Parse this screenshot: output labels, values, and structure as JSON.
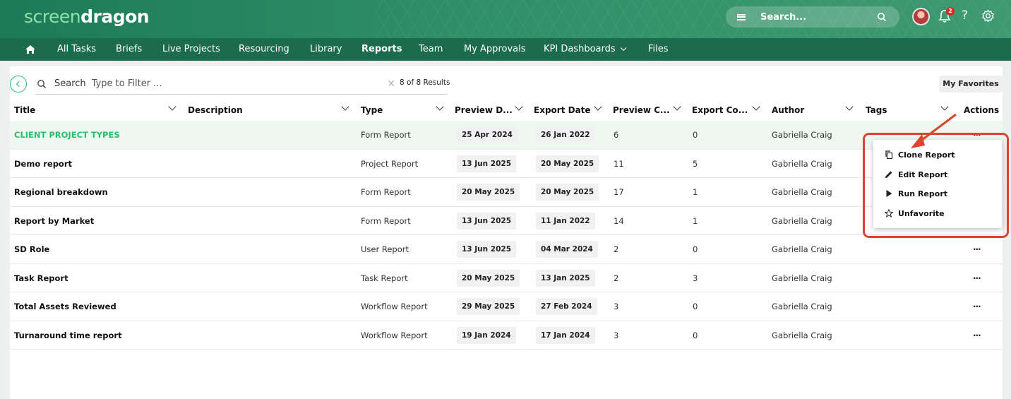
{
  "app": {
    "logo_light": "screen",
    "logo_bold": "dragon"
  },
  "header": {
    "search_placeholder": "Search...",
    "notification_count": "2",
    "help_label": "?"
  },
  "nav": {
    "items": [
      {
        "label": "All Tasks"
      },
      {
        "label": "Briefs"
      },
      {
        "label": "Live Projects"
      },
      {
        "label": "Resourcing"
      },
      {
        "label": "Library"
      },
      {
        "label": "Reports",
        "active": true
      },
      {
        "label": "Team"
      },
      {
        "label": "My Approvals"
      },
      {
        "label": "KPI Dashboards",
        "has_dropdown": true
      },
      {
        "label": "Files"
      }
    ]
  },
  "toolbar": {
    "search_label": "Search",
    "filter_placeholder": "Type to Filter ...",
    "results_text": "8 of 8 Results",
    "favorites_button": "My Favorites"
  },
  "table": {
    "columns": [
      "Title",
      "Description",
      "Type",
      "Preview D...",
      "Export Date",
      "Preview C...",
      "Export Co...",
      "Author",
      "Tags",
      "Actions"
    ],
    "rows": [
      {
        "title": "CLIENT PROJECT TYPES",
        "description": "",
        "type": "Form Report",
        "preview_date": "25 Apr 2024",
        "export_date": "26 Jan 2022",
        "preview_count": "6",
        "export_count": "0",
        "author": "Gabriella Craig",
        "tags": "",
        "actions": "..."
      },
      {
        "title": "Demo report",
        "description": "",
        "type": "Project Report",
        "preview_date": "13 Jun 2025",
        "export_date": "20 May 2025",
        "preview_count": "11",
        "export_count": "5",
        "author": "Gabriella Craig",
        "tags": "",
        "actions": "..."
      },
      {
        "title": "Regional breakdown",
        "description": "",
        "type": "Form Report",
        "preview_date": "20 May 2025",
        "export_date": "20 May 2025",
        "preview_count": "17",
        "export_count": "1",
        "author": "Gabriella Craig",
        "tags": "",
        "actions": "..."
      },
      {
        "title": "Report by Market",
        "description": "",
        "type": "Form Report",
        "preview_date": "13 Jun 2025",
        "export_date": "11 Jan 2022",
        "preview_count": "14",
        "export_count": "1",
        "author": "Gabriella Craig",
        "tags": "",
        "actions": "..."
      },
      {
        "title": "SD Role",
        "description": "",
        "type": "User Report",
        "preview_date": "13 Jun 2025",
        "export_date": "04 Mar 2024",
        "preview_count": "2",
        "export_count": "0",
        "author": "Gabriella Craig",
        "tags": "",
        "actions": "..."
      },
      {
        "title": "Task Report",
        "description": "",
        "type": "Task Report",
        "preview_date": "20 May 2025",
        "export_date": "13 Jan 2025",
        "preview_count": "2",
        "export_count": "3",
        "author": "Gabriella Craig",
        "tags": "",
        "actions": "..."
      },
      {
        "title": "Total Assets Reviewed",
        "description": "",
        "type": "Workflow Report",
        "preview_date": "29 May 2025",
        "export_date": "27 Feb 2024",
        "preview_count": "3",
        "export_count": "0",
        "author": "Gabriella Craig",
        "tags": "",
        "actions": "..."
      },
      {
        "title": "Turnaround time report",
        "description": "",
        "type": "Workflow Report",
        "preview_date": "19 Jan 2024",
        "export_date": "17 Jan 2024",
        "preview_count": "3",
        "export_count": "0",
        "author": "Gabriella Craig",
        "tags": "",
        "actions": "..."
      }
    ]
  },
  "context_menu": {
    "items": [
      {
        "label": "Clone Report",
        "icon": "copy-icon"
      },
      {
        "label": "Edit Report",
        "icon": "pencil-icon"
      },
      {
        "label": "Run Report",
        "icon": "play-icon"
      },
      {
        "label": "Unfavorite",
        "icon": "star-icon"
      }
    ]
  },
  "colors": {
    "header_green": "#2f8f67",
    "nav_green": "#1c6b4f",
    "accent_green": "#2ebd6e",
    "annotation_red": "#d9452e"
  }
}
